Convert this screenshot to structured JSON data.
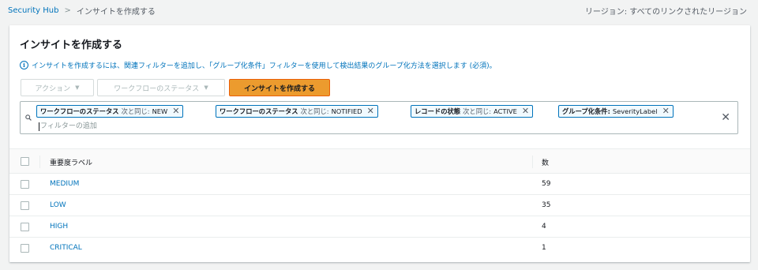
{
  "breadcrumb": {
    "root": "Security Hub",
    "current": "インサイトを作成する"
  },
  "region": "リージョン: すべてのリンクされたリージョン",
  "panel": {
    "title": "インサイトを作成する",
    "info_text": "インサイトを作成するには、関連フィルターを追加し、「グループ化条件」フィルターを使用して検出結果のグループ化方法を選択します (必須)。",
    "buttons": {
      "action": "アクション",
      "workflow": "ワークフローのステータス",
      "create": "インサイトを作成する"
    }
  },
  "filters": [
    {
      "field": "ワークフローのステータス",
      "op": "次と同じ:",
      "value": "NEW"
    },
    {
      "field": "ワークフローのステータス",
      "op": "次と同じ:",
      "value": "NOTIFIED"
    },
    {
      "field": "レコードの状態",
      "op": "次と同じ:",
      "value": "ACTIVE"
    },
    {
      "field": "グループ化条件:",
      "op": "",
      "value": "SeverityLabel"
    }
  ],
  "filter_placeholder": "フィルターの追加",
  "table": {
    "headers": [
      "重要度ラベル",
      "数"
    ],
    "rows": [
      {
        "label": "MEDIUM",
        "count": "59"
      },
      {
        "label": "LOW",
        "count": "35"
      },
      {
        "label": "HIGH",
        "count": "4"
      },
      {
        "label": "CRITICAL",
        "count": "1"
      }
    ]
  },
  "colors": {
    "link": "#0073bb",
    "primary": "#ec9b2e",
    "chip_border": "#0073bb"
  }
}
